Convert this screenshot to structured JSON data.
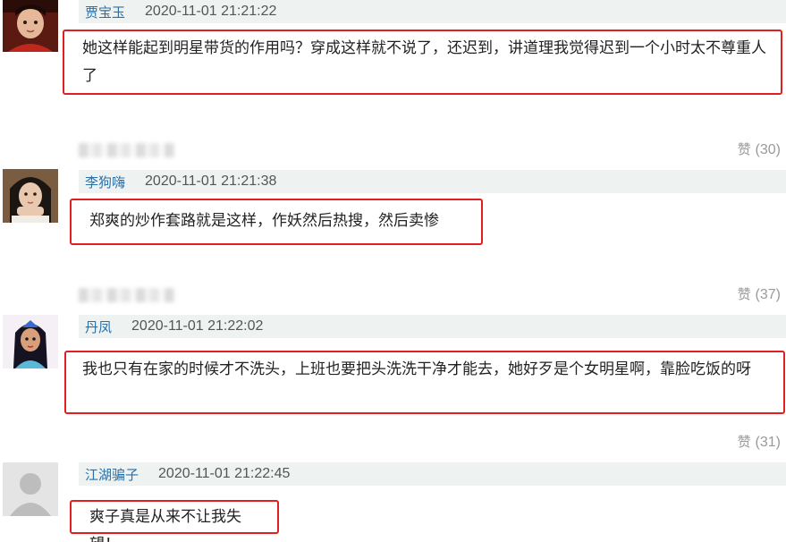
{
  "comments": [
    {
      "username": "贾宝玉",
      "timestamp": "2020-11-01 21:21:22",
      "text": "她这样能起到明星带货的作用吗？穿成这样就不说了，还迟到，讲道理我觉得迟到一个小时太不尊重人了",
      "likes_label": "赞",
      "likes_count": "(30)"
    },
    {
      "username": "李狗嗨",
      "timestamp": "2020-11-01 21:21:38",
      "text": "郑爽的炒作套路就是这样，作妖然后热搜，然后卖惨",
      "likes_label": "赞",
      "likes_count": "(37)"
    },
    {
      "username": "丹凤",
      "timestamp": "2020-11-01 21:22:02",
      "text": "我也只有在家的时候才不洗头，上班也要把头洗洗干净才能去，她好歹是个女明星啊，靠脸吃饭的呀",
      "likes_label": "赞",
      "likes_count": "(31)"
    },
    {
      "username": "江湖骗子",
      "timestamp": "2020-11-01 21:22:45",
      "text": "爽子真是从来不让我失望！"
    }
  ]
}
